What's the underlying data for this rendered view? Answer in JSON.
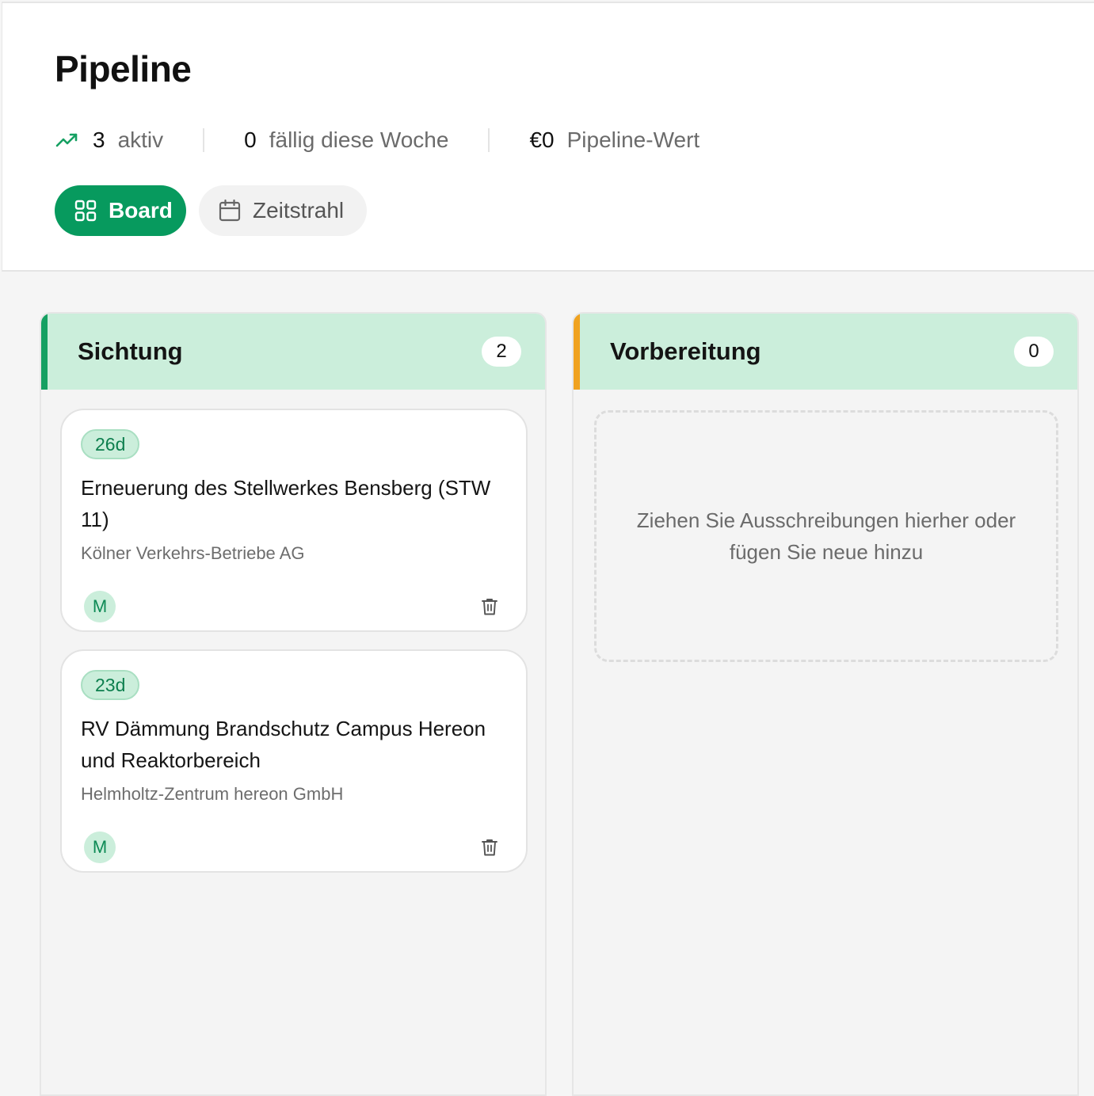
{
  "page": {
    "title": "Pipeline"
  },
  "stats": {
    "active_count": "3",
    "active_label": "aktiv",
    "due_count": "0",
    "due_label": "fällig diese Woche",
    "value_amount": "€0",
    "value_label": "Pipeline-Wert",
    "trend_icon": "trending-up-icon"
  },
  "views": {
    "board_label": "Board",
    "board_icon": "grid-icon",
    "timeline_label": "Zeitstrahl",
    "timeline_icon": "calendar-icon",
    "active": "Board"
  },
  "colors": {
    "primary": "#079a5e",
    "column_header_bg": "#cbeedb",
    "sichtung_accent": "#15a062",
    "vorbereitung_accent": "#f0a21f"
  },
  "columns": [
    {
      "title": "Sichtung",
      "count": "2",
      "cards": [
        {
          "days": "26d",
          "title": "Erneuerung des Stellwerkes Bensberg (STW 11)",
          "organization": "Kölner Verkehrs-Betriebe AG",
          "assignee_initial": "M"
        },
        {
          "days": "23d",
          "title": "RV Dämmung Brandschutz Campus Hereon und Reaktorbereich",
          "organization": "Helmholtz-Zentrum hereon GmbH",
          "assignee_initial": "M"
        }
      ]
    },
    {
      "title": "Vorbereitung",
      "count": "0",
      "empty_text": "Ziehen Sie Ausschreibungen hierher oder fügen Sie neue hinzu",
      "cards": []
    }
  ]
}
